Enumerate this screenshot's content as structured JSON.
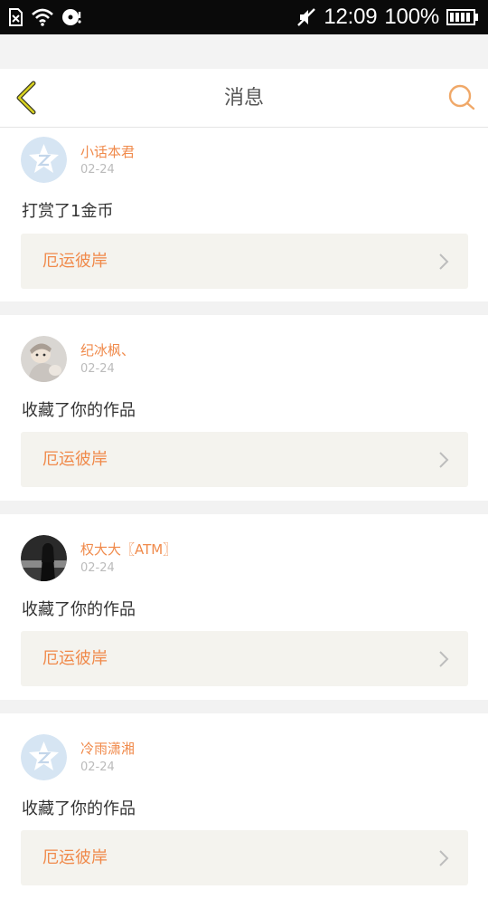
{
  "status_bar": {
    "time": "12:09",
    "battery": "100%",
    "icons": [
      "sim-error-icon",
      "wifi-icon",
      "disc-icon",
      "mute-icon",
      "battery-icon"
    ]
  },
  "header": {
    "title": "消息",
    "back_icon": "chevron-left-icon",
    "search_icon": "search-icon"
  },
  "colors": {
    "accent": "#f08a4b",
    "back_arrow": "#c9c21a",
    "link_bg": "#f4f3ee",
    "default_avatar": "#cfe0f1"
  },
  "messages": [
    {
      "user": "小话本君",
      "date": "02-24",
      "text": "打赏了1金币",
      "work": "厄运彼岸",
      "avatar": "default-qzone-avatar"
    },
    {
      "user": "纪冰枫、",
      "date": "02-24",
      "text": "收藏了你的作品",
      "work": "厄运彼岸",
      "avatar": "photo-avatar-child"
    },
    {
      "user": "权大大〖ATM〗",
      "date": "02-24",
      "text": "收藏了你的作品",
      "work": "厄运彼岸",
      "avatar": "photo-avatar-dark"
    },
    {
      "user": "冷雨潇湘",
      "date": "02-24",
      "text": "收藏了你的作品",
      "work": "厄运彼岸",
      "avatar": "default-qzone-avatar"
    }
  ]
}
